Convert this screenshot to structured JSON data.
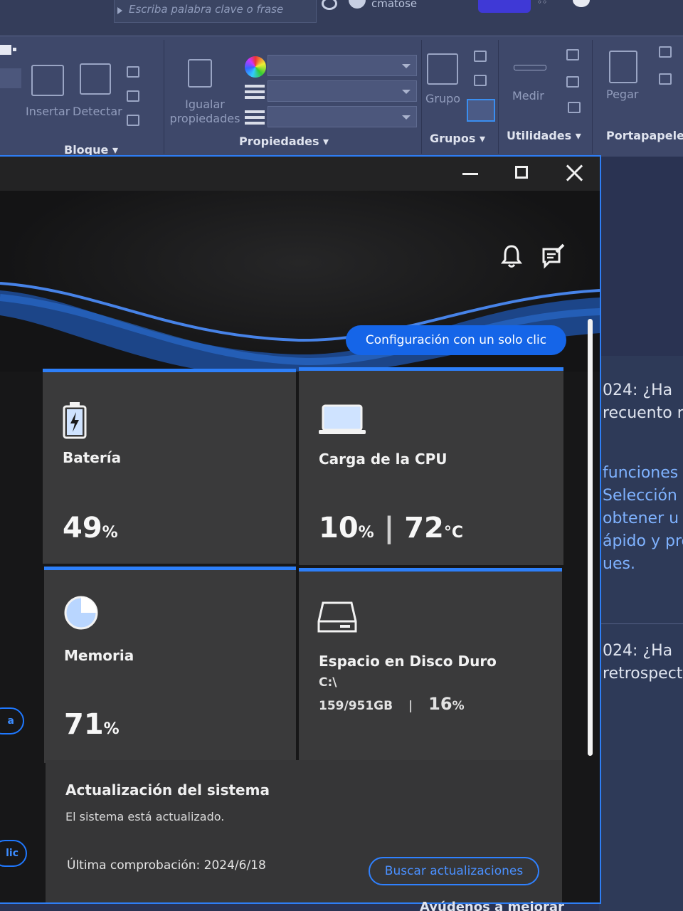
{
  "cad": {
    "search_placeholder": "Escriba palabra clave o frase",
    "user_name": "cmatose",
    "ribbon": {
      "insert_label": "Insertar",
      "detect_label": "Detectar",
      "match_props_label": "Igualar propiedades",
      "group_label": "Grupo",
      "measure_label": "Medir",
      "paste_label": "Pegar",
      "groups": {
        "block": "Bloque ▾",
        "properties": "Propiedades ▾",
        "groups": "Grupos ▾",
        "utilities": "Utilidades ▾",
        "clipboard": "Portapapeles"
      }
    },
    "side_doc": {
      "lines": [
        "024: ¿Ha",
        "recuento rá",
        "funciones",
        "Selección",
        "obtener u",
        "ápido y pre",
        "ues.",
        "024: ¿Ha",
        "retrospecti"
      ]
    },
    "footer_text": "Ayúdenos a mejorar"
  },
  "app": {
    "one_click_label": "Configuración con un solo clic",
    "cards": {
      "battery": {
        "title": "Batería",
        "value": "49",
        "unit": "%"
      },
      "cpu": {
        "title": "Carga de la CPU",
        "load": "10",
        "load_unit": "%",
        "separator": "|",
        "temp": "72",
        "temp_unit": "°C"
      },
      "memory": {
        "title": "Memoria",
        "value": "71",
        "unit": "%"
      },
      "disk": {
        "title": "Espacio en Disco Duro",
        "drive": "C:\\",
        "usage": "159/951GB",
        "separator": "|",
        "percent": "16",
        "unit": "%"
      }
    },
    "update": {
      "title": "Actualización del sistema",
      "status": "El sistema está actualizado.",
      "last_check": "Última comprobación: 2024/6/18",
      "button_label": "Buscar actualizaciones"
    },
    "left_pills": [
      "a",
      "lic"
    ],
    "colors": {
      "accent": "#1565e8",
      "card": "#3a3a3b",
      "window_border": "#2e7ef5"
    }
  }
}
